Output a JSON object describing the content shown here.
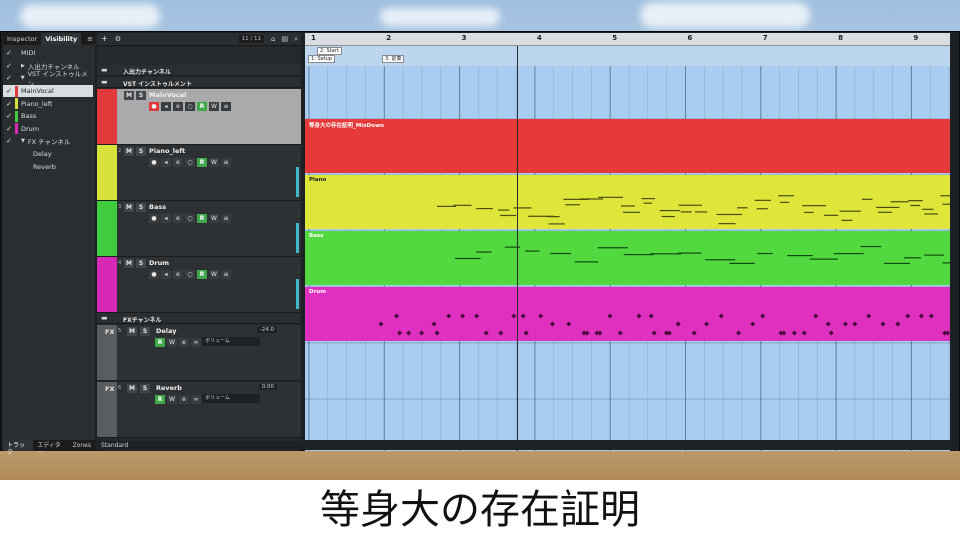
{
  "caption": "等身大の存在証明",
  "left_panel": {
    "tabs": [
      "Inspector",
      "Visibility"
    ],
    "menu_icon": "≡",
    "visibility_items": [
      {
        "label": "MIDI",
        "checked": true,
        "type": "plain",
        "color": ""
      },
      {
        "label": "入出力チャンネル",
        "checked": true,
        "type": "folder",
        "color": ""
      },
      {
        "label": "VST インストゥルメン",
        "checked": true,
        "type": "folder-open",
        "color": ""
      },
      {
        "label": "MainVocal",
        "checked": true,
        "type": "track",
        "color": "#e23a3a",
        "selected": true
      },
      {
        "label": "Piano_left",
        "checked": true,
        "type": "track",
        "color": "#d9e23a"
      },
      {
        "label": "Bass",
        "checked": true,
        "type": "track",
        "color": "#3fcc3f"
      },
      {
        "label": "Drum",
        "checked": true,
        "type": "track",
        "color": "#d62ab6"
      },
      {
        "label": "FX チャンネル",
        "checked": true,
        "type": "folder-open",
        "color": ""
      },
      {
        "label": "Delay",
        "checked": false,
        "type": "child",
        "color": ""
      },
      {
        "label": "Reverb",
        "checked": false,
        "type": "child",
        "color": ""
      }
    ],
    "bottom_tabs": [
      "トラック",
      "エディター",
      "Zones"
    ]
  },
  "track_list": {
    "counter": "11 / 11",
    "footer_label": "Standard",
    "folders": [
      {
        "name": "入出力チャンネル"
      },
      {
        "name": "VST インストゥルメント"
      },
      {
        "name": "FXチャンネル"
      }
    ],
    "tracks": [
      {
        "num": "1",
        "name": "MainVocal",
        "color": "#e23a3a"
      },
      {
        "num": "2",
        "name": "Piano_left",
        "color": "#d9e23a"
      },
      {
        "num": "3",
        "name": "Bass",
        "color": "#3fcc3f"
      },
      {
        "num": "4",
        "name": "Drum",
        "color": "#d62ab6"
      }
    ],
    "fx_tracks": [
      {
        "num": "5",
        "name": "Delay",
        "volume": "-24.0",
        "route": "ボリューム"
      },
      {
        "num": "6",
        "name": "Reverb",
        "volume": "0.00",
        "route": "ボリューム"
      }
    ],
    "m_label": "M",
    "s_label": "S",
    "r_label": "R",
    "w_label": "W",
    "fx_label": "FX"
  },
  "arrange": {
    "bars": [
      "1",
      "2",
      "3",
      "4",
      "5",
      "6",
      "7",
      "8",
      "9"
    ],
    "markers": [
      "2: Start",
      "1: Setup",
      "3: 前奏"
    ],
    "parts": [
      {
        "name": "等身大の存在証明_MixDown",
        "color": "#e63a3a"
      },
      {
        "name": "Piano",
        "color": "#dfe63a"
      },
      {
        "name": "Bass",
        "color": "#52d93f"
      },
      {
        "name": "Drum",
        "color": "#e030c0"
      }
    ]
  }
}
